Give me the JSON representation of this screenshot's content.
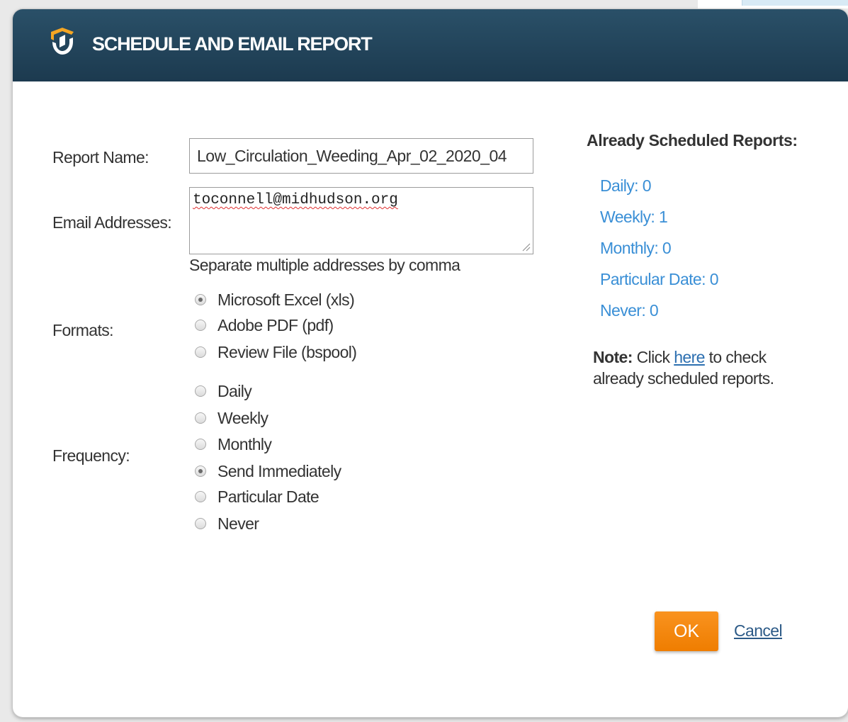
{
  "dialog": {
    "title": "SCHEDULE AND EMAIL REPORT",
    "accent_color": "#ef7d00",
    "titlebar_color": "#1f4257"
  },
  "form": {
    "report_name_label": "Report Name:",
    "report_name_value": "Low_Circulation_Weeding_Apr_02_2020_04",
    "email_label": "Email Addresses:",
    "email_value": "toconnell@midhudson.org",
    "email_hint": "Separate multiple addresses by comma",
    "formats_label": "Formats:",
    "formats": [
      {
        "label": "Microsoft Excel (xls)",
        "selected": true
      },
      {
        "label": "Adobe PDF (pdf)",
        "selected": false
      },
      {
        "label": "Review File (bspool)",
        "selected": false
      }
    ],
    "frequency_label": "Frequency:",
    "frequency": [
      {
        "label": "Daily",
        "selected": false
      },
      {
        "label": "Weekly",
        "selected": false
      },
      {
        "label": "Monthly",
        "selected": false
      },
      {
        "label": "Send Immediately",
        "selected": true
      },
      {
        "label": "Particular Date",
        "selected": false
      },
      {
        "label": "Never",
        "selected": false
      }
    ]
  },
  "scheduled": {
    "heading": "Already Scheduled Reports:",
    "items": [
      {
        "label": "Daily: 0"
      },
      {
        "label": "Weekly: 1"
      },
      {
        "label": "Monthly: 0"
      },
      {
        "label": "Particular Date: 0"
      },
      {
        "label": "Never: 0"
      }
    ],
    "note_prefix": "Note:",
    "note_before": " Click ",
    "note_link": "here",
    "note_after": " to check already scheduled reports."
  },
  "actions": {
    "ok_label": "OK",
    "cancel_label": "Cancel"
  }
}
